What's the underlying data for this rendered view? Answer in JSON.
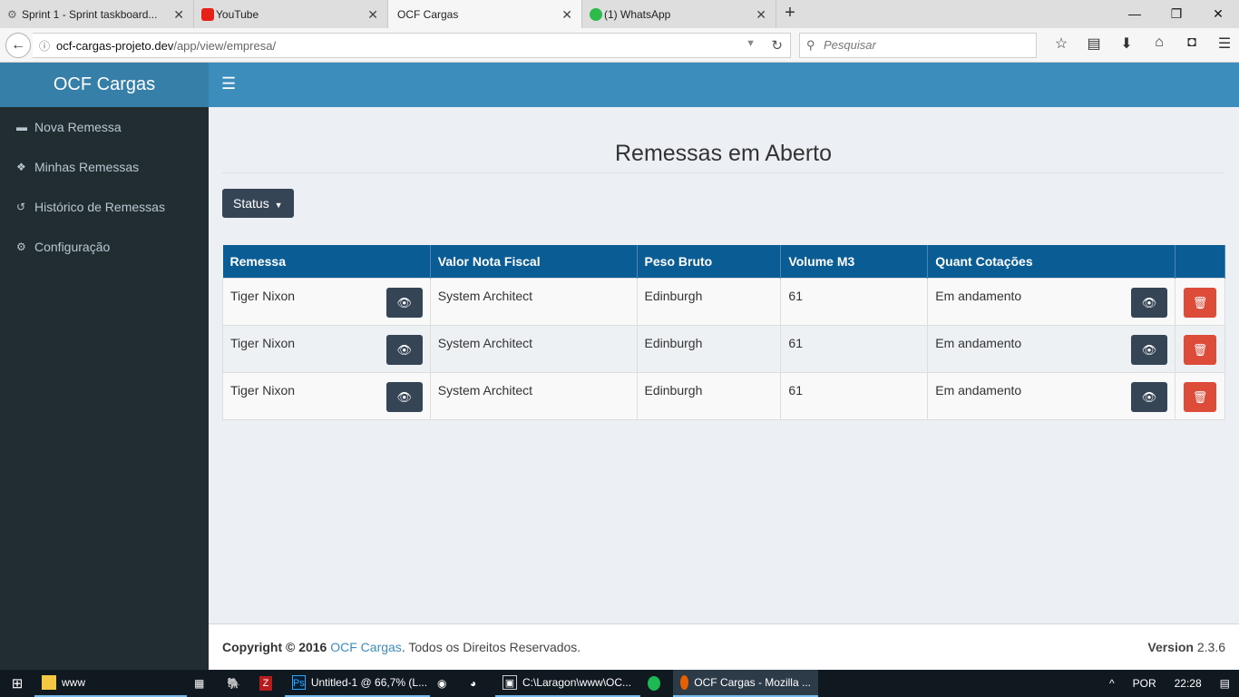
{
  "browser": {
    "tabs": [
      {
        "title": "Sprint 1 - Sprint taskboard...",
        "active": false
      },
      {
        "title": "YouTube",
        "active": false
      },
      {
        "title": "OCF Cargas",
        "active": true
      },
      {
        "title": "(1) WhatsApp",
        "active": false
      }
    ],
    "url_host": "ocf-cargas-projeto.dev",
    "url_path": "/app/view/empresa/",
    "search_placeholder": "Pesquisar"
  },
  "app": {
    "brand": "OCF Cargas",
    "menu": [
      {
        "label": "Nova Remessa",
        "icon": "truck-icon"
      },
      {
        "label": "Minhas Remessas",
        "icon": "cubes-icon"
      },
      {
        "label": "Histórico de Remessas",
        "icon": "history-icon"
      },
      {
        "label": "Configuração",
        "icon": "gears-icon"
      }
    ]
  },
  "main": {
    "title": "Remessas em Aberto",
    "status_button": "Status",
    "table": {
      "headers": [
        "Remessa",
        "Valor Nota Fiscal",
        "Peso Bruto",
        "Volume M3",
        "Quant Cotações",
        ""
      ],
      "rows": [
        {
          "remessa": "Tiger Nixon",
          "valor": "System Architect",
          "peso": "Edinburgh",
          "volume": "61",
          "cotacoes": "Em andamento"
        },
        {
          "remessa": "Tiger Nixon",
          "valor": "System Architect",
          "peso": "Edinburgh",
          "volume": "61",
          "cotacoes": "Em andamento"
        },
        {
          "remessa": "Tiger Nixon",
          "valor": "System Architect",
          "peso": "Edinburgh",
          "volume": "61",
          "cotacoes": "Em andamento"
        }
      ]
    }
  },
  "footer": {
    "copyright": "Copyright © 2016",
    "company": "OCF Cargas",
    "rights": ". Todos os Direitos Reservados.",
    "version_label": "Version",
    "version": "2.3.6"
  },
  "taskbar": {
    "items": [
      "www",
      "Untitled-1 @ 66,7% (L...",
      "C:\\Laragon\\www\\OC...",
      "OCF Cargas - Mozilla ..."
    ],
    "language": "POR",
    "time": "22:28"
  },
  "colors": {
    "sidebar": "#222d32",
    "header": "#3c8dbc",
    "brand": "#367fa9",
    "table_header": "#0a5c95",
    "danger": "#dd4b39",
    "dark_button": "#364556"
  }
}
